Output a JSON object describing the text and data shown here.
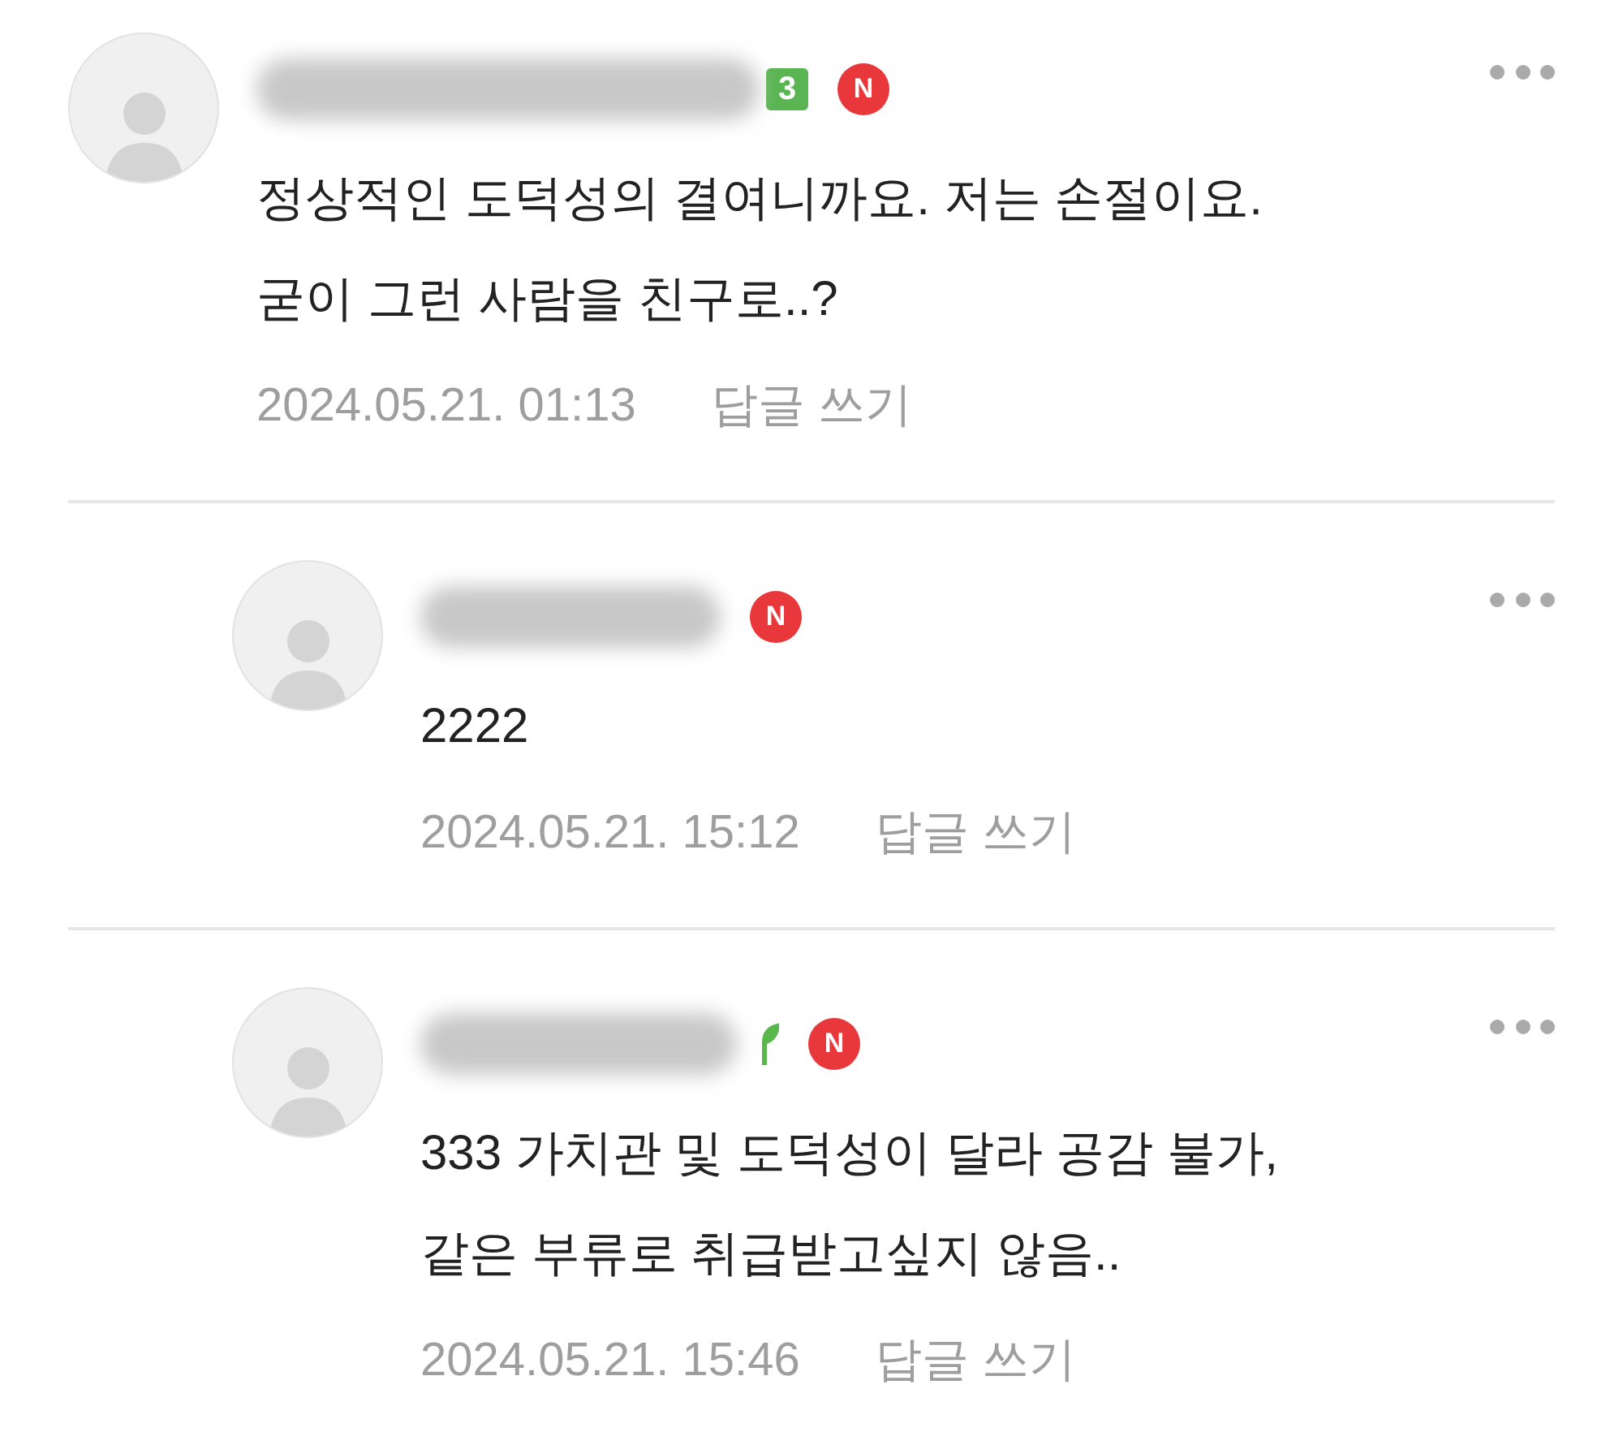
{
  "comments": [
    {
      "kind": "comment",
      "badges": [
        {
          "kind": "level",
          "text": "3"
        },
        {
          "kind": "new",
          "text": "N"
        }
      ],
      "lines": [
        "정상적인 도덕성의 결여니까요. 저는 손절이요.",
        "굳이 그런 사람을 친구로..?"
      ],
      "date": "2024.05.21. 01:13",
      "reply_label": "답글 쓰기"
    },
    {
      "kind": "reply",
      "badges": [
        {
          "kind": "new",
          "text": "N"
        }
      ],
      "lines": [
        "2222"
      ],
      "date": "2024.05.21. 15:12",
      "reply_label": "답글 쓰기"
    },
    {
      "kind": "reply",
      "badges": [
        {
          "kind": "sprout"
        },
        {
          "kind": "new",
          "text": "N"
        }
      ],
      "lines": [
        "333 가치관 및 도덕성이 달라 공감 불가,",
        "같은 부류로 취급받고싶지 않음.."
      ],
      "date": "2024.05.21. 15:46",
      "reply_label": "답글 쓰기"
    }
  ]
}
